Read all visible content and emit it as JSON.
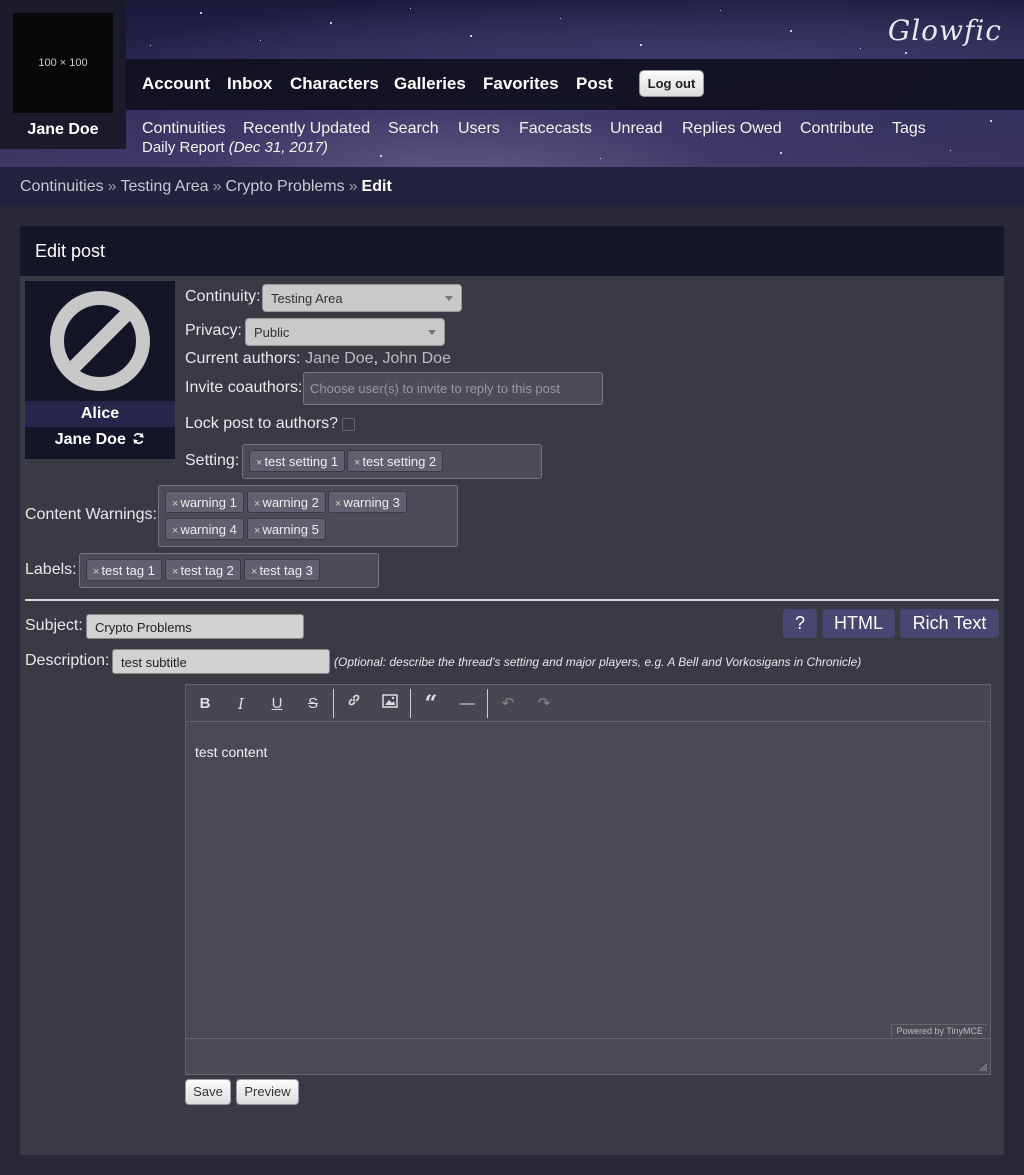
{
  "site": {
    "logo": "Glowfic"
  },
  "user_box": {
    "avatar_placeholder": "100 × 100",
    "username": "Jane Doe"
  },
  "nav": {
    "items": [
      "Account",
      "Inbox",
      "Characters",
      "Galleries",
      "Favorites",
      "Post"
    ],
    "logout_label": "Log out"
  },
  "subnav": {
    "items": [
      "Continuities",
      "Recently Updated",
      "Search",
      "Users",
      "Facecasts",
      "Unread",
      "Replies Owed",
      "Contribute",
      "Tags"
    ],
    "daily_label": "Daily Report",
    "daily_date": "(Dec 31, 2017)"
  },
  "breadcrumb": {
    "items": [
      "Continuities",
      "Testing Area",
      "Crypto Problems"
    ],
    "current": "Edit",
    "separator": "»"
  },
  "panel": {
    "title": "Edit post"
  },
  "character": {
    "name": "Alice",
    "user": "Jane Doe",
    "icon": "no-icon-placeholder",
    "swap_icon": "refresh-icon"
  },
  "form": {
    "continuity_label": "Continuity:",
    "continuity_value": "Testing Area",
    "privacy_label": "Privacy:",
    "privacy_value": "Public",
    "authors_label": "Current authors:",
    "authors": [
      "Jane Doe",
      "John Doe"
    ],
    "authors_sep": ",",
    "invite_label": "Invite coauthors:",
    "invite_placeholder": "Choose user(s) to invite to reply to this post",
    "lock_label": "Lock post to authors?",
    "lock_checked": false,
    "setting_label": "Setting:",
    "settings": [
      "test setting 1",
      "test setting 2"
    ],
    "warnings_label": "Content Warnings:",
    "warnings": [
      "warning 1",
      "warning 2",
      "warning 3",
      "warning 4",
      "warning 5"
    ],
    "labels_label": "Labels:",
    "labels": [
      "test tag 1",
      "test tag 2",
      "test tag 3"
    ],
    "tag_remove": "×",
    "subject_label": "Subject:",
    "subject_value": "Crypto Problems",
    "description_label": "Description:",
    "description_value": "test subtitle",
    "description_hint": "(Optional: describe the thread's setting and major players, e.g. A Bell and Vorkosigans in Chronicle)",
    "help_button": "?",
    "html_button": "HTML",
    "rich_text_button": "Rich Text"
  },
  "editor": {
    "toolbar": [
      "bold",
      "italic",
      "underline",
      "strikethrough",
      "link",
      "image",
      "blockquote",
      "horizontal-rule",
      "undo",
      "redo"
    ],
    "content": "test content",
    "powered_by": "Powered by TinyMCE"
  },
  "actions": {
    "save_label": "Save",
    "preview_label": "Preview"
  }
}
